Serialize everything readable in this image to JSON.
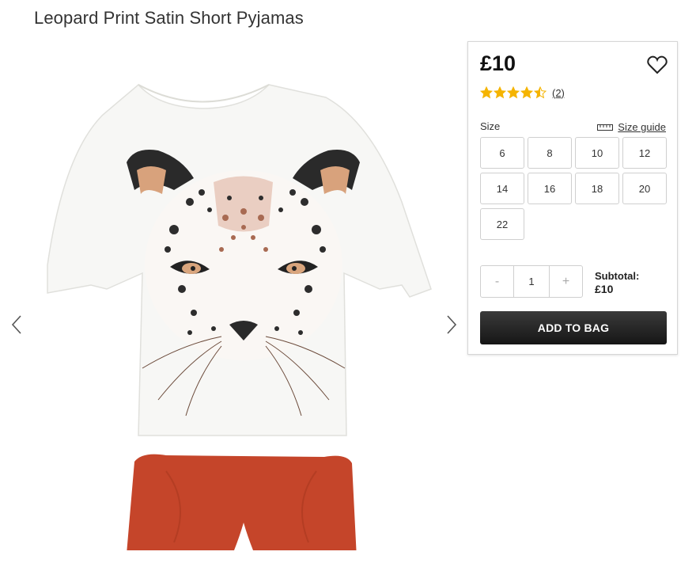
{
  "product": {
    "title": "Leopard Print Satin Short Pyjamas"
  },
  "panel": {
    "price": "£10",
    "rating": {
      "value": 4.5,
      "max": 5,
      "review_count": "(2)",
      "star_color": "#f5b400"
    },
    "size_label": "Size",
    "size_guide_label": "Size guide",
    "sizes": [
      "6",
      "8",
      "10",
      "12",
      "14",
      "16",
      "18",
      "20",
      "22"
    ],
    "quantity": {
      "minus": "-",
      "value": "1",
      "plus": "+"
    },
    "subtotal_label": "Subtotal:",
    "subtotal_value": "£10",
    "add_to_bag": "ADD TO BAG"
  },
  "colors": {
    "shorts": "#c5452a",
    "button_dark": "#1f1f1f"
  },
  "icons": [
    "chevron-left-icon",
    "chevron-right-icon",
    "heart-icon",
    "ruler-icon",
    "star-icon"
  ]
}
